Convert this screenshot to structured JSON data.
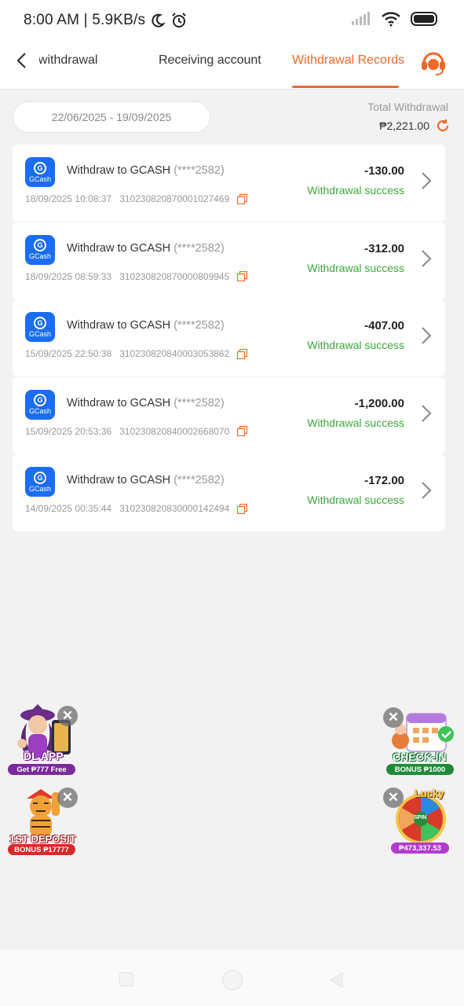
{
  "status_bar": {
    "time": "8:00 AM | 5.9KB/s"
  },
  "header": {
    "tabs": [
      {
        "label": "st withdrawal"
      },
      {
        "label": "Receiving account"
      },
      {
        "label": "Withdrawal Records",
        "active": true
      }
    ]
  },
  "filter": {
    "date_range": "22/06/2025 - 19/09/2025",
    "total_label": "Total Withdrawal",
    "total_value": "₱2,221.00"
  },
  "records": [
    {
      "title": "Withdraw to GCASH",
      "account": "(****2582)",
      "datetime": "18/09/2025 10:08:37",
      "order_id": "310230820870001027469",
      "amount": "-130.00",
      "status": "Withdrawal success",
      "logo_text": "GCash"
    },
    {
      "title": "Withdraw to GCASH",
      "account": "(****2582)",
      "datetime": "18/09/2025 08:59:33",
      "order_id": "310230820870000809945",
      "amount": "-312.00",
      "status": "Withdrawal success",
      "logo_text": "GCash"
    },
    {
      "title": "Withdraw to GCASH",
      "account": "(****2582)",
      "datetime": "15/09/2025 22:50:38",
      "order_id": "310230820840003053862",
      "amount": "-407.00",
      "status": "Withdrawal success",
      "logo_text": "GCash"
    },
    {
      "title": "Withdraw to GCASH",
      "account": "(****2582)",
      "datetime": "15/09/2025 20:53:36",
      "order_id": "310230820840002668070",
      "amount": "-1,200.00",
      "status": "Withdrawal success",
      "logo_text": "GCash"
    },
    {
      "title": "Withdraw to GCASH",
      "account": "(****2582)",
      "datetime": "14/09/2025 00:35:44",
      "order_id": "310230820830000142494",
      "amount": "-172.00",
      "status": "Withdrawal success",
      "logo_text": "GCash"
    }
  ],
  "promos": {
    "dl_app": {
      "caption": "DL APP",
      "band": "Get ₱777 Free"
    },
    "check_in": {
      "caption": "CHECK-IN",
      "band": "BONUS ₱1000"
    },
    "first_deposit": {
      "caption": "1ST DEPOSIT",
      "band": "BONUS ₱17777"
    },
    "lucky_spin": {
      "caption": "Lucky",
      "center": "SPIN",
      "band": "₱473,337.53"
    }
  },
  "colors": {
    "accent": "#f0692a",
    "success": "#3aa83a",
    "gcash": "#1a6df5"
  }
}
